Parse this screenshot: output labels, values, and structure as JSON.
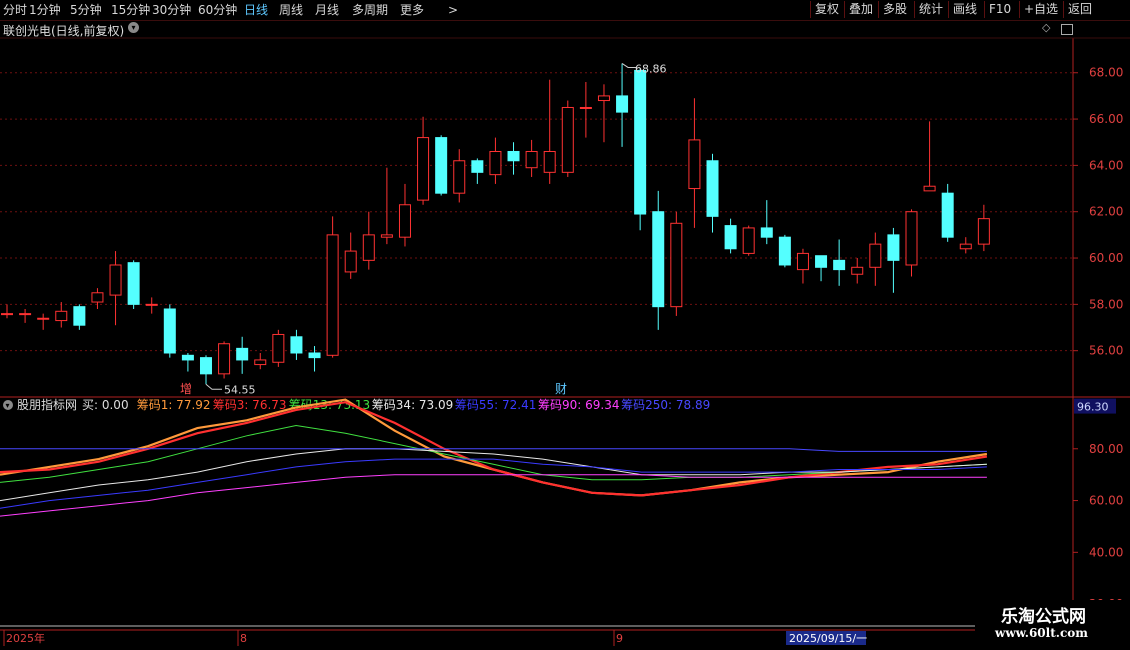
{
  "toolbar": {
    "periods": [
      "分时",
      "1分钟",
      "5分钟",
      "15分钟",
      "30分钟",
      "60分钟",
      "日线",
      "周线",
      "月线",
      "多周期",
      "更多"
    ],
    "active_period": "日线",
    "more_arrow": ">",
    "right_buttons": [
      "复权",
      "叠加",
      "多股",
      "统计",
      "画线",
      "F10",
      "+自选",
      "返回"
    ]
  },
  "stock": {
    "title": "联创光电(日线,前复权)"
  },
  "price_panel": {
    "y_ticks": [
      "68.00",
      "66.00",
      "64.00",
      "62.00",
      "60.00",
      "58.00",
      "56.00"
    ],
    "high_label": "68.86",
    "low_label": "54.55",
    "markers": [
      "增",
      "财"
    ]
  },
  "indicator": {
    "name": "股朋指标网",
    "items": [
      {
        "label": "买: 0.00",
        "color": "#dcdcdc"
      },
      {
        "label": "筹码1: 77.92",
        "color": "#ff9a3c"
      },
      {
        "label": "筹码3: 76.73",
        "color": "#ff3030"
      },
      {
        "label": "筹码13: 73.13",
        "color": "#40e040"
      },
      {
        "label": "筹码34: 73.09",
        "color": "#e8e8e8"
      },
      {
        "label": "筹码55: 72.41",
        "color": "#3a3aff"
      },
      {
        "label": "筹码90: 69.34",
        "color": "#ff40ff"
      },
      {
        "label": "筹码250: 78.89",
        "color": "#4848ff"
      }
    ],
    "y_ticks": [
      "80.00",
      "60.00",
      "40.00",
      "20.00"
    ],
    "current_value": "96.30"
  },
  "time_axis": {
    "labels": [
      "2025年",
      "8",
      "9",
      "2025/09/15/一"
    ]
  },
  "watermark": {
    "line1": "乐淘公式网",
    "line2": "www.60lt.com"
  },
  "colors": {
    "up": "#ff3232",
    "down": "#54ffff",
    "grid": "#6e1010",
    "axis": "#b02020",
    "active": "#5ec8ff"
  },
  "chart_data": {
    "type": "candlestick",
    "price_candles": [
      [
        57.6,
        57.6,
        58.0,
        57.4
      ],
      [
        57.6,
        57.6,
        57.8,
        57.2
      ],
      [
        57.4,
        57.4,
        57.6,
        56.9
      ],
      [
        57.3,
        57.7,
        58.1,
        57.0
      ],
      [
        57.9,
        57.1,
        58.0,
        56.9
      ],
      [
        58.1,
        58.5,
        58.7,
        57.8
      ],
      [
        58.4,
        59.7,
        60.3,
        57.1
      ],
      [
        59.8,
        58.0,
        59.9,
        57.8
      ],
      [
        58.0,
        58.0,
        58.3,
        57.6
      ],
      [
        57.8,
        55.9,
        58.0,
        55.7
      ],
      [
        55.8,
        55.6,
        55.9,
        55.1
      ],
      [
        55.7,
        55.0,
        55.8,
        54.55
      ],
      [
        55.0,
        56.3,
        56.4,
        54.8
      ],
      [
        56.1,
        55.6,
        56.6,
        55.0
      ],
      [
        55.4,
        55.6,
        55.9,
        55.2
      ],
      [
        55.5,
        56.7,
        56.9,
        55.3
      ],
      [
        56.6,
        55.9,
        56.9,
        55.6
      ],
      [
        55.9,
        55.7,
        56.2,
        55.1
      ],
      [
        55.8,
        61.0,
        61.8,
        55.7
      ],
      [
        59.4,
        60.3,
        61.1,
        59.1
      ],
      [
        59.9,
        61.0,
        62.0,
        59.5
      ],
      [
        60.9,
        61.0,
        63.9,
        60.6
      ],
      [
        60.9,
        62.3,
        63.2,
        60.5
      ],
      [
        62.5,
        65.2,
        66.1,
        62.3
      ],
      [
        65.2,
        62.8,
        65.3,
        62.7
      ],
      [
        62.8,
        64.2,
        64.7,
        62.4
      ],
      [
        64.2,
        63.7,
        64.3,
        63.2
      ],
      [
        63.6,
        64.6,
        65.2,
        63.2
      ],
      [
        64.6,
        64.2,
        65.0,
        63.6
      ],
      [
        63.9,
        64.6,
        65.1,
        63.5
      ],
      [
        63.7,
        64.6,
        67.7,
        63.2
      ],
      [
        63.7,
        66.5,
        66.8,
        63.5
      ],
      [
        66.5,
        66.5,
        67.6,
        65.2
      ],
      [
        66.8,
        67.0,
        67.5,
        65.0
      ],
      [
        67.0,
        66.3,
        68.4,
        64.8
      ],
      [
        68.1,
        61.9,
        68.2,
        61.2
      ],
      [
        62.0,
        57.9,
        62.9,
        56.9
      ],
      [
        57.9,
        61.5,
        62.0,
        57.5
      ],
      [
        63.0,
        65.1,
        66.9,
        61.3
      ],
      [
        64.2,
        61.8,
        64.5,
        61.1
      ],
      [
        61.4,
        60.4,
        61.7,
        60.2
      ],
      [
        60.2,
        61.3,
        61.4,
        60.1
      ],
      [
        61.3,
        60.9,
        62.5,
        60.6
      ],
      [
        60.9,
        59.7,
        61.0,
        59.6
      ],
      [
        59.5,
        60.2,
        60.4,
        58.9
      ],
      [
        60.1,
        59.6,
        60.1,
        59.0
      ],
      [
        59.9,
        59.5,
        60.8,
        58.8
      ],
      [
        59.3,
        59.6,
        60.0,
        58.9
      ],
      [
        59.6,
        60.6,
        61.1,
        58.8
      ],
      [
        61.0,
        59.9,
        61.3,
        58.5
      ],
      [
        59.7,
        62.0,
        62.1,
        59.2
      ],
      [
        62.9,
        63.1,
        65.9,
        62.9
      ],
      [
        62.8,
        60.9,
        63.2,
        60.7
      ],
      [
        60.4,
        60.6,
        60.9,
        60.2
      ],
      [
        60.6,
        61.7,
        62.3,
        60.3
      ]
    ],
    "price_range": [
      54,
      69.5
    ],
    "indicator_series": [
      {
        "name": "筹码1",
        "color": "#ff9a3c",
        "values": [
          70,
          73,
          76,
          81,
          88,
          91,
          96,
          99,
          87,
          77,
          72,
          67,
          63,
          62,
          64,
          67,
          69,
          70,
          71,
          75,
          78
        ]
      },
      {
        "name": "筹码3",
        "color": "#ff3030",
        "values": [
          71,
          72,
          75,
          80,
          86,
          90,
          95,
          98,
          90,
          80,
          72,
          67,
          63,
          62,
          64,
          66,
          69,
          71,
          73,
          74,
          77
        ]
      },
      {
        "name": "筹码13",
        "color": "#40e040",
        "values": [
          67,
          69,
          72,
          75,
          80,
          85,
          89,
          86,
          82,
          78,
          74,
          70,
          68,
          68,
          69,
          69,
          70,
          71,
          72,
          73,
          74
        ]
      },
      {
        "name": "筹码34",
        "color": "#e8e8e8",
        "values": [
          60,
          63,
          66,
          68,
          71,
          75,
          78,
          80,
          80,
          79,
          78,
          76,
          73,
          70,
          70,
          70,
          71,
          71,
          72,
          73,
          74
        ]
      },
      {
        "name": "筹码55",
        "color": "#3a3aff",
        "values": [
          57,
          60,
          62,
          64,
          67,
          70,
          73,
          75,
          76,
          76,
          76,
          74,
          73,
          71,
          71,
          71,
          71,
          72,
          72,
          72,
          73
        ]
      },
      {
        "name": "筹码90",
        "color": "#ff40ff",
        "values": [
          54,
          56,
          58,
          60,
          63,
          65,
          67,
          69,
          70,
          70,
          70,
          70,
          70,
          70,
          69,
          69,
          69,
          69,
          69,
          69,
          69
        ]
      },
      {
        "name": "筹码250",
        "color": "#4848ff",
        "values": [
          80,
          80,
          80,
          80,
          80,
          80,
          80,
          80,
          80,
          80,
          80,
          80,
          80,
          80,
          80,
          80,
          80,
          79,
          79,
          79,
          79
        ]
      }
    ],
    "indicator_range": [
      10,
      100
    ]
  }
}
